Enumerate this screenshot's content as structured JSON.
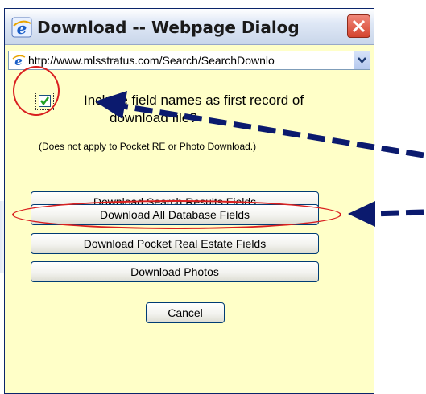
{
  "dialog": {
    "title": "Download -- Webpage Dialog",
    "address": "http://www.mlsstratus.com/Search/SearchDownlo",
    "include_question_line1": "Include field names as first record of",
    "include_question_line2": "download file?",
    "include_checked": true,
    "note": "(Does not apply to Pocket RE or Photo Download.)",
    "buttons": {
      "search_results": "Download Search Results Fields",
      "all_database": "Download All Database Fields",
      "pocket_real_estate": "Download Pocket Real Estate Fields",
      "photos": "Download Photos",
      "cancel": "Cancel"
    }
  },
  "icons": {
    "browser": "ie-icon",
    "close": "close-icon",
    "dropdown": "chevron-down-icon",
    "check": "check-icon"
  },
  "colors": {
    "dialog_bg": "#ffffc8",
    "highlight_red": "#d92020",
    "arrow_blue": "#0b1a6e",
    "close_red": "#d4442e"
  }
}
